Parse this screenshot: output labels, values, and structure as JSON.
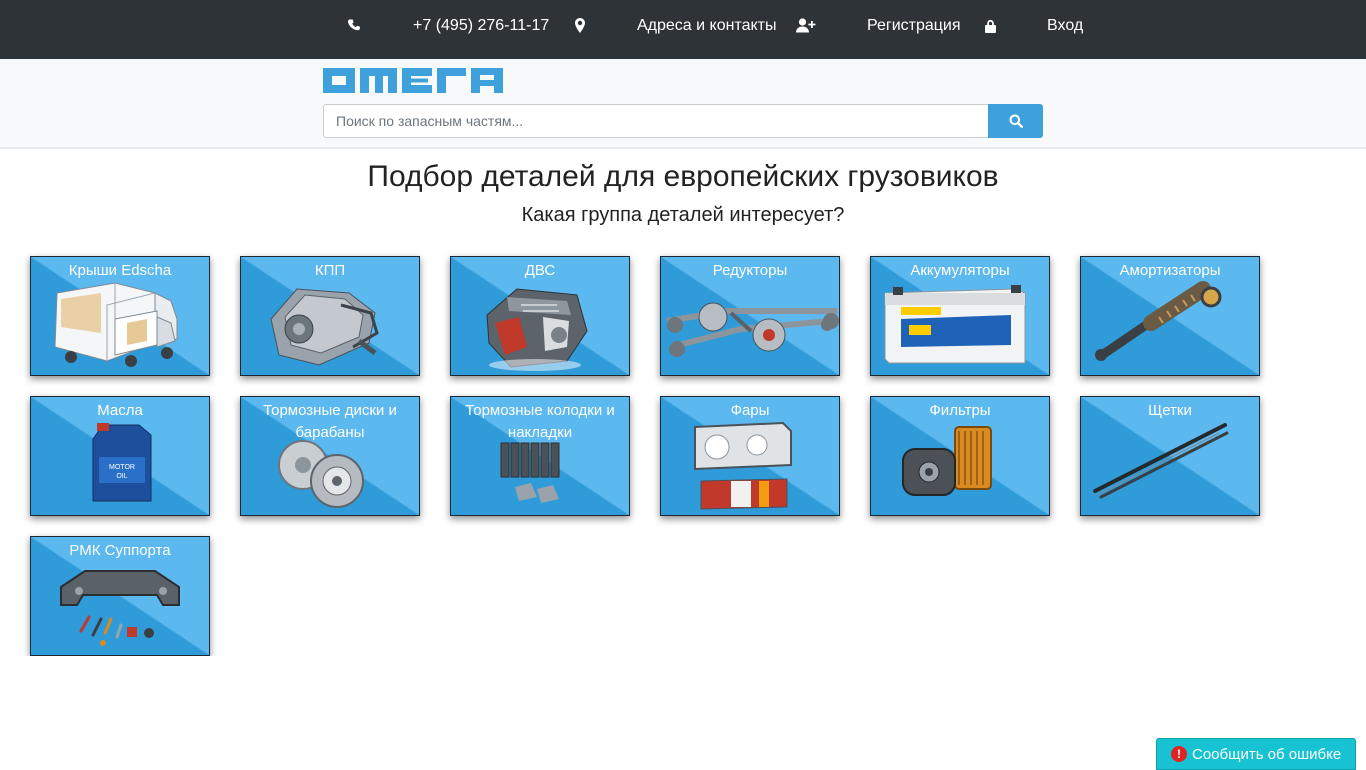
{
  "topbar": {
    "phone": "+7 (495) 276-11-17",
    "addresses": "Адреса и контакты",
    "register": "Регистрация",
    "login": "Вход"
  },
  "header": {
    "logo_text": "ОМЕГА",
    "search_placeholder": "Поиск по запасным частям..."
  },
  "main": {
    "title": "Подбор деталей для европейских грузовиков",
    "subtitle": "Какая группа деталей интересует?"
  },
  "categories": [
    {
      "label": "Крыши Edscha"
    },
    {
      "label": "КПП"
    },
    {
      "label": "ДВС"
    },
    {
      "label": "Редукторы"
    },
    {
      "label": "Аккумуляторы"
    },
    {
      "label": "Амортизаторы"
    },
    {
      "label": "Масла"
    },
    {
      "label": "Тормозные диски и барабаны"
    },
    {
      "label": "Тормозные колодки и накладки"
    },
    {
      "label": "Фары"
    },
    {
      "label": "Фильтры"
    },
    {
      "label": "Щетки"
    },
    {
      "label": "РМК Суппорта"
    }
  ],
  "report": {
    "label": "Сообщить об ошибке"
  },
  "colors": {
    "topbar": "#2d3336",
    "accent": "#3fa1dc",
    "card_dark": "#2f9bd8",
    "card_light": "#5cb9ef",
    "report": "#17c3d3"
  }
}
